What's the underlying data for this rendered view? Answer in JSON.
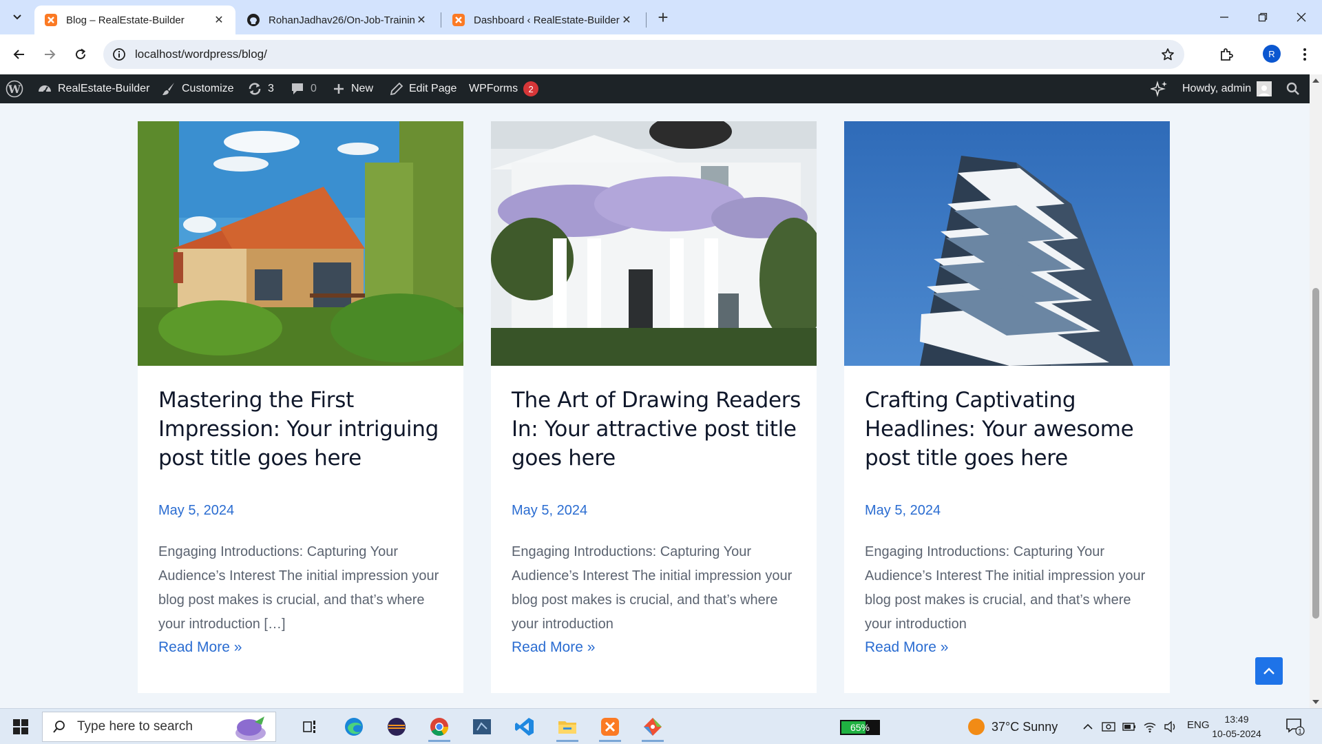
{
  "browser": {
    "tabs": [
      {
        "title": "Blog – RealEstate-Builder",
        "active": true
      },
      {
        "title": "RohanJadhav26/On-Job-Trainin",
        "active": false
      },
      {
        "title": "Dashboard ‹ RealEstate-Builder",
        "active": false
      }
    ],
    "url": "localhost/wordpress/blog/",
    "profile_initial": "R"
  },
  "admin_bar": {
    "site_name": "RealEstate-Builder",
    "customize": "Customize",
    "updates_count": "3",
    "comments_count": "0",
    "new": "New",
    "edit_page": "Edit Page",
    "wpforms": "WPForms",
    "wpforms_badge": "2",
    "howdy": "Howdy, admin"
  },
  "posts": [
    {
      "title": "Mastering the First Impression: Your intriguing post title goes here",
      "date": "May 5, 2024",
      "excerpt": "Engaging Introductions: Capturing Your Audience’s Interest The initial impression your blog post makes is crucial, and that’s where your introduction […]",
      "read_more": "Read More »",
      "image": "wooden-house-photo"
    },
    {
      "title": "The Art of Drawing Readers In: Your attractive post title goes here",
      "date": "May 5, 2024",
      "excerpt": "Engaging Introductions: Capturing Your Audience’s Interest The initial impression your blog post makes is crucial, and that’s where your introduction",
      "read_more": "Read More »",
      "image": "white-house-wisteria-photo"
    },
    {
      "title": "Crafting Captivating Headlines: Your awesome post title goes here",
      "date": "May 5, 2024",
      "excerpt": "Engaging Introductions: Capturing Your Audience’s Interest The initial impression your blog post makes is crucial, and that’s where your introduction",
      "read_more": "Read More »",
      "image": "modern-tower-photo"
    }
  ],
  "taskbar": {
    "search_placeholder": "Type here to search",
    "battery": "65%",
    "battery_level": 0.65,
    "weather": "37°C  Sunny",
    "language": "ENG",
    "time": "13:49",
    "date": "10-05-2024",
    "notification_count": "1"
  },
  "colors": {
    "accent": "#2a6cd1",
    "admin_bar": "#1d2327",
    "page_bg": "#f0f5fa",
    "tabstrip": "#d3e3fd"
  }
}
